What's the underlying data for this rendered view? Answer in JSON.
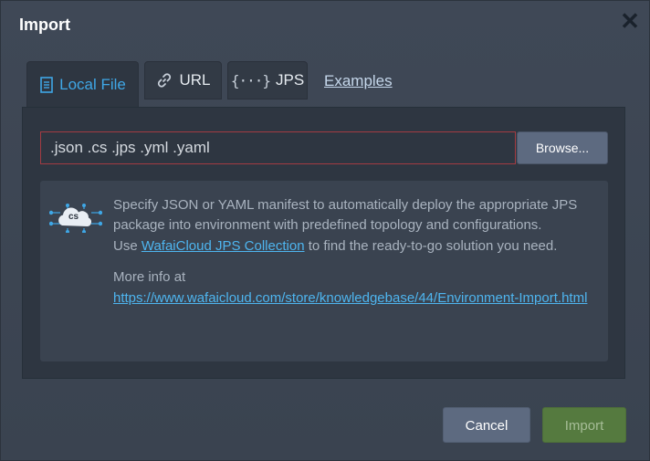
{
  "dialog": {
    "title": "Import",
    "close_icon": "close-icon"
  },
  "tabs": [
    {
      "label": "Local File",
      "icon": "document-icon",
      "active": true
    },
    {
      "label": "URL",
      "icon": "link-icon",
      "active": false
    },
    {
      "label": "JPS",
      "icon": "braces-icon",
      "active": false
    }
  ],
  "examples_link": "Examples",
  "file_input": {
    "placeholder": ".json .cs .jps .yml .yaml",
    "value": ""
  },
  "browse_button": "Browse...",
  "info": {
    "icon": "cloud-cs-icon",
    "icon_label": "cs",
    "line1": "Specify JSON or YAML manifest to automatically deploy the appropriate JPS package into environment with predefined topology and configurations.",
    "use_prefix": "Use ",
    "collection_link": "WafaiCloud JPS Collection",
    "use_suffix": " to find the ready-to-go solution you need.",
    "more_info": "More info at",
    "kb_link": "https://www.wafaicloud.com/store/knowledgebase/44/Environment-Import.html"
  },
  "footer": {
    "cancel_label": "Cancel",
    "import_label": "Import"
  },
  "colors": {
    "accent": "#3fa7e6",
    "error_border": "#a33b42",
    "import_button": "#557a3f",
    "cancel_button": "#5d6a80"
  }
}
